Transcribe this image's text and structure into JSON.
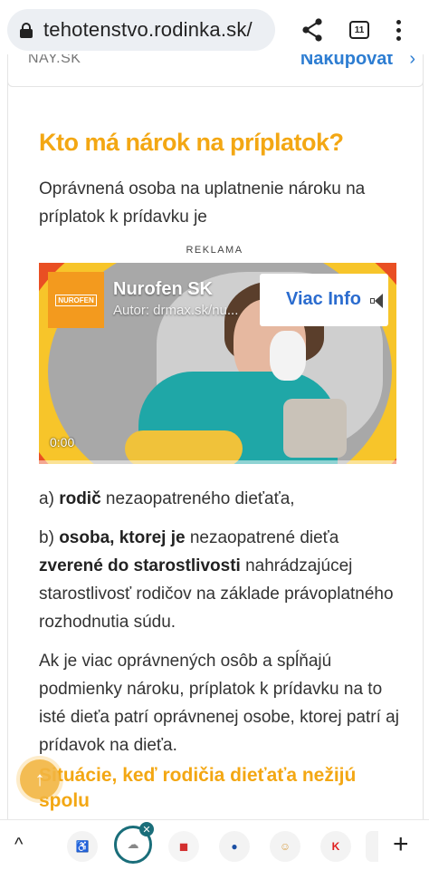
{
  "browser": {
    "url": "tehotenstvo.rodinka.sk/",
    "tab_count": "11",
    "icons": [
      "lock-icon",
      "share-icon",
      "tabs-icon",
      "menu-icon"
    ]
  },
  "partial_row": {
    "left_text": "NAY.SK",
    "right_link": "Nakupovať",
    "chevron": "›"
  },
  "article": {
    "heading": "Kto má nárok na príplatok?",
    "intro": "Oprávnená osoba na uplatnenie nároku na príplatok k prídavku je",
    "ad_label": "REKLAMA",
    "item_a": {
      "prefix": "a) ",
      "bold": "rodič",
      "rest": " nezaopatreného dieťaťa,"
    },
    "item_b": {
      "prefix": "b) ",
      "bold1": "osoba, ktorej je",
      "mid": " nezaopatrené dieťa ",
      "bold2": "zverené do starostlivosti",
      "rest": " nahrádzajúcej starostlivosť rodičov na základe právoplatného rozhodnutia súdu."
    },
    "para_more": "Ak je viac oprávnených osôb a spĺňajú podmienky nároku, príplatok k prídavku na to isté dieťa patrí oprávnenej osobe, ktorej patrí aj prídavok na dieťa.",
    "subheading": "Situácie, keď rodičia dieťaťa nežijú spolu"
  },
  "video_ad": {
    "logo_text": "NUROFEN",
    "title": "Nurofen SK",
    "author": "Autor: drmax.sk/nu...",
    "info_button": "Viac Info",
    "time": "0:00"
  },
  "bottom_bar": {
    "caret": "^",
    "plus": "+",
    "close": "✕"
  },
  "colors": {
    "accent": "#f3a713",
    "link": "#2d7dd2",
    "info_blue": "#2b6ccf",
    "active_tab": "#1a6e7a"
  }
}
